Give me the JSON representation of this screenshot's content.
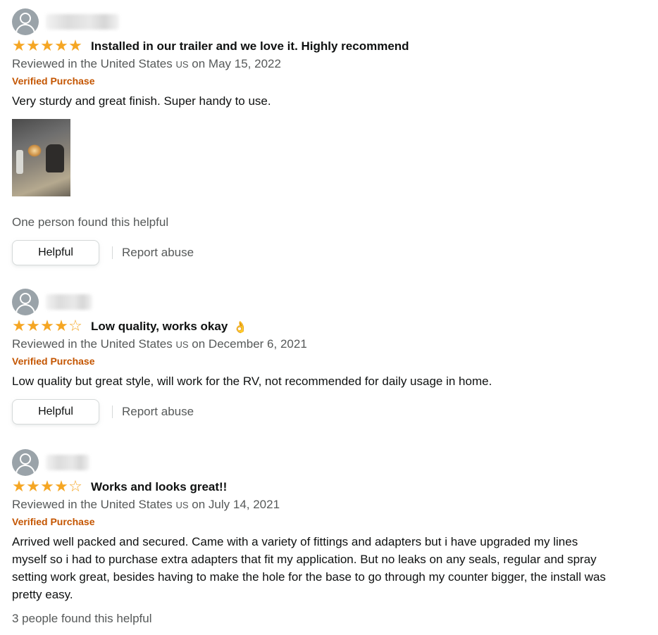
{
  "reviews": [
    {
      "rating": 5,
      "title": "Installed in our trailer and we love it. Highly recommend",
      "meta_prefix": "Reviewed in the United States",
      "country_code": "US",
      "meta_date": "on May 15, 2022",
      "verified": "Verified Purchase",
      "body": "Very sturdy and great finish. Super handy to use.",
      "helpful_count": "One person found this helpful",
      "helpful_button": "Helpful",
      "report_link": "Report abuse"
    },
    {
      "rating": 4,
      "title": "Low quality, works okay",
      "emoji": "👌",
      "meta_prefix": "Reviewed in the United States",
      "country_code": "US",
      "meta_date": "on December 6, 2021",
      "verified": "Verified Purchase",
      "body": "Low quality but great style, will work for the RV, not recommended for daily usage in home.",
      "helpful_button": "Helpful",
      "report_link": "Report abuse"
    },
    {
      "rating": 4,
      "title": "Works and looks great!!",
      "meta_prefix": "Reviewed in the United States",
      "country_code": "US",
      "meta_date": "on July 14, 2021",
      "verified": "Verified Purchase",
      "body": "Arrived well packed and secured. Came with a variety of fittings and adapters but i have upgraded my lines myself so i had to purchase extra adapters that fit my application. But no leaks on any seals, regular and spray setting work great, besides having to make the hole for the base to go through my counter bigger, the install was pretty easy.",
      "helpful_count": "3 people found this helpful"
    }
  ],
  "colors": {
    "star": "#f5a623",
    "verified": "#c45500",
    "meta": "#565959",
    "text": "#0f1111"
  }
}
